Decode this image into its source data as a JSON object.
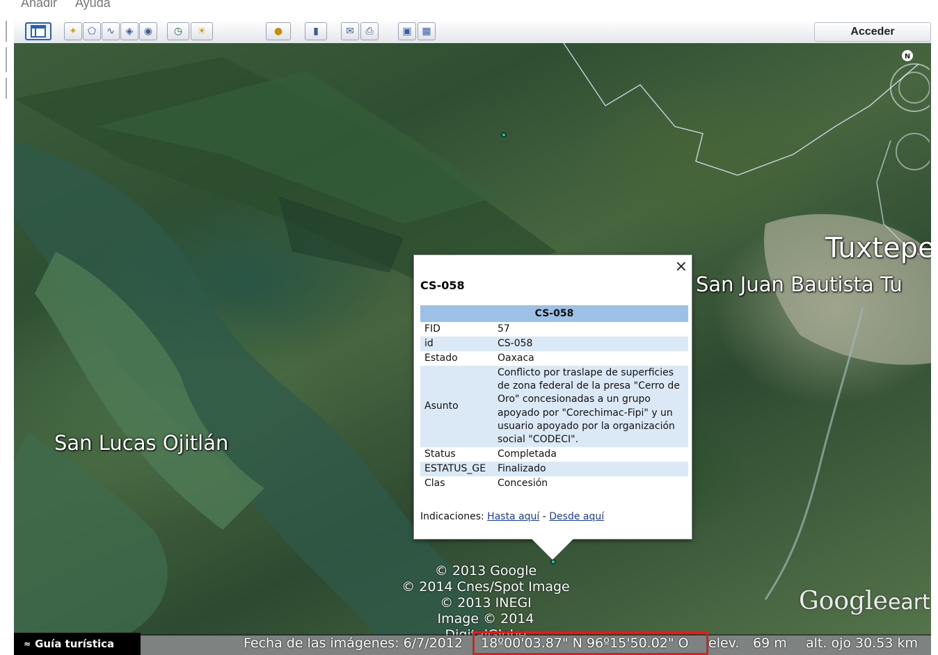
{
  "menu": {
    "items": [
      "Añadir",
      "Ayuda"
    ]
  },
  "toolbar": {
    "buttons": [
      "sidebar-icon",
      "placemark-icon",
      "polygon-icon",
      "path-icon",
      "overlay-icon",
      "tour-icon",
      "history-icon",
      "sun-icon",
      "planet-icon",
      "ruler-icon",
      "email-icon",
      "print-icon",
      "maps-icon",
      "save-image-icon"
    ],
    "login_label": "Acceder"
  },
  "map": {
    "labels": {
      "tuxtepec": "Tuxtepe",
      "san_juan": "San Juan Bautista Tu",
      "san_lucas": "San Lucas Ojitlán"
    },
    "credits": [
      "© 2013 Google",
      "© 2014 Cnes/Spot Image",
      "© 2013 INEGI",
      "Image © 2014 DigitalGlobe"
    ],
    "logo": {
      "main": "Google",
      "suffix": "eart"
    },
    "compass_letter": "N"
  },
  "popup": {
    "title": "CS-058",
    "table_header": "CS-058",
    "rows": [
      {
        "key": "FID",
        "value": "57"
      },
      {
        "key": "id",
        "value": "CS-058"
      },
      {
        "key": "Estado",
        "value": "Oaxaca"
      },
      {
        "key": "Asunto",
        "value": "Conflicto por traslape de superficies de zona federal de la presa \"Cerro de Oro\" concesionadas a un grupo apoyado por \"Corechimac-Fipi\" y un usuario apoyado por la organización social \"CODECI\"."
      },
      {
        "key": "Status",
        "value": "Completada"
      },
      {
        "key": "ESTATUS_GE",
        "value": "Finalizado"
      },
      {
        "key": "Clas",
        "value": "Concesión"
      }
    ],
    "directions_label": "Indicaciones:",
    "link_to": "Hasta aquí",
    "separator": " - ",
    "link_from": "Desde aquí",
    "close_glyph": "×"
  },
  "status": {
    "tour_label": "Guía turística",
    "tour_glyph": "≈",
    "imagery_date": "Fecha de las imágenes: 6/7/2012",
    "coordinates": "18º00'03.87\" N  96º15'50.02\" O",
    "elevation_label": "elev.",
    "elevation_value": "69 m",
    "eye_alt": "alt. ojo  30.53 km"
  }
}
